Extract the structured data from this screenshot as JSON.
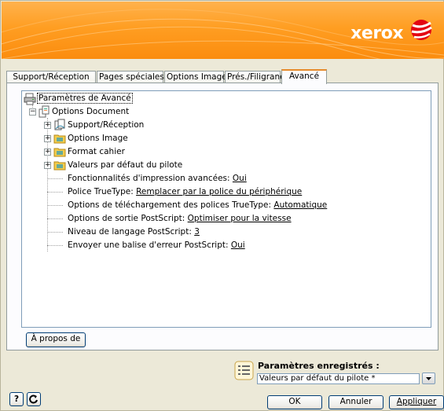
{
  "brand": {
    "logo_text": "xerox",
    "color": "#ff9a1f",
    "logo_accent": "#d40000"
  },
  "tabs": [
    {
      "label": "Support/Réception",
      "active": false
    },
    {
      "label": "Pages spéciales",
      "active": false
    },
    {
      "label": "Options Image",
      "active": false
    },
    {
      "label": "Prés./Filigrane",
      "active": false
    },
    {
      "label": "Avancé",
      "active": true
    }
  ],
  "tree": {
    "root": "Paramètres de Avancé",
    "options_document": "Options Document",
    "folders": [
      "Support/Réception",
      "Options Image",
      "Format cahier",
      "Valeurs par défaut du pilote"
    ],
    "settings": [
      {
        "label": "Fonctionnalités d'impression avancées: ",
        "value": "Oui"
      },
      {
        "label": "Police TrueType: ",
        "value": "Remplacer par la police du périphérique"
      },
      {
        "label": "Options de téléchargement des polices TrueType: ",
        "value": "Automatique"
      },
      {
        "label": "Options de sortie PostScript: ",
        "value": "Optimiser pour la vitesse"
      },
      {
        "label": "Niveau de langage PostScript: ",
        "value": "3"
      },
      {
        "label": "Envoyer une balise d'erreur PostScript: ",
        "value": "Oui"
      }
    ]
  },
  "about_button": "À propos de",
  "saved_settings": {
    "label": "Paramètres enregistrés :",
    "value": "Valeurs par défaut du pilote *"
  },
  "footer": {
    "help": "?",
    "ok": "OK",
    "cancel": "Annuler",
    "apply": "Appliquer"
  },
  "icons": {
    "help": "question-icon",
    "reset": "reset-icon",
    "saved": "saved-settings-icon",
    "printer": "printer-icon",
    "document": "document-options-icon",
    "folder": "folder-icon"
  }
}
